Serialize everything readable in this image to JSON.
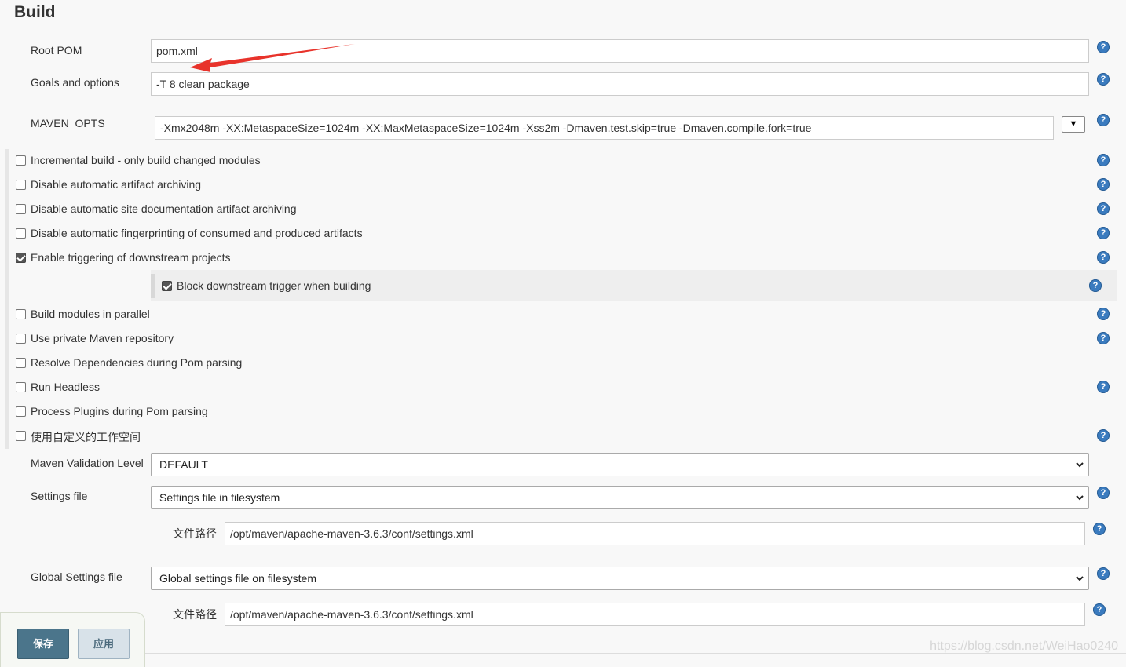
{
  "section": {
    "title": "Build"
  },
  "fields": {
    "root_pom": {
      "label": "Root POM",
      "value": "pom.xml"
    },
    "goals": {
      "label": "Goals and options",
      "value": "-T 8 clean package"
    },
    "maven_opts": {
      "label": "MAVEN_OPTS",
      "value": "-Xmx2048m -XX:MetaspaceSize=1024m -XX:MaxMetaspaceSize=1024m -Xss2m -Dmaven.test.skip=true -Dmaven.compile.fork=true",
      "dropdown_glyph": "▼"
    }
  },
  "checkboxes": [
    {
      "label": "Incremental build - only build changed modules",
      "checked": false
    },
    {
      "label": "Disable automatic artifact archiving",
      "checked": false
    },
    {
      "label": "Disable automatic site documentation artifact archiving",
      "checked": false
    },
    {
      "label": "Disable automatic fingerprinting of consumed and produced artifacts",
      "checked": false
    },
    {
      "label": "Enable triggering of downstream projects",
      "checked": true
    },
    {
      "label": "Block downstream trigger when building",
      "checked": true
    },
    {
      "label": "Build modules in parallel",
      "checked": false
    },
    {
      "label": "Use private Maven repository",
      "checked": false
    },
    {
      "label": "Resolve Dependencies during Pom parsing",
      "checked": false
    },
    {
      "label": "Run Headless",
      "checked": false
    },
    {
      "label": "Process Plugins during Pom parsing",
      "checked": false
    },
    {
      "label": "使用自定义的工作空间",
      "checked": false
    }
  ],
  "validation": {
    "label": "Maven Validation Level",
    "value": "DEFAULT"
  },
  "settings": {
    "label": "Settings file",
    "value": "Settings file in filesystem",
    "path_label": "文件路径",
    "path_value": "/opt/maven/apache-maven-3.6.3/conf/settings.xml"
  },
  "global_settings": {
    "label": "Global Settings file",
    "value": "Global settings file on filesystem",
    "path_label": "文件路径",
    "path_value": "/opt/maven/apache-maven-3.6.3/conf/settings.xml"
  },
  "buttons": {
    "save": "保存",
    "apply": "应用"
  },
  "help_glyph": "?",
  "watermark": "https://blog.csdn.net/WeiHao0240",
  "colors": {
    "help": "#3a7bbf",
    "save": "#4b758b",
    "arrow": "#e8332b"
  }
}
